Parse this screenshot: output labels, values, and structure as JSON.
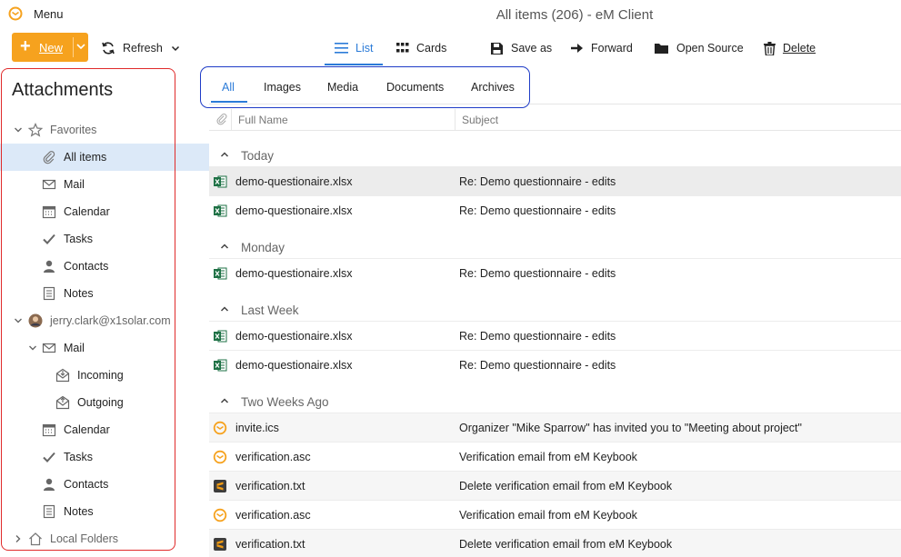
{
  "window": {
    "title": "All items (206) - eM Client",
    "menu_label": "Menu"
  },
  "toolbar": {
    "new_label": "New",
    "refresh_label": "Refresh",
    "list_label": "List",
    "cards_label": "Cards",
    "save_as_label": "Save as",
    "forward_label": "Forward",
    "open_source_label": "Open Source",
    "delete_label": "Delete"
  },
  "sidebar": {
    "title": "Attachments",
    "favorites_label": "Favorites",
    "account_label": "jerry.clark@x1solar.com",
    "local_folders_label": "Local Folders",
    "favorites": [
      {
        "label": "All items",
        "icon": "paperclip-icon"
      },
      {
        "label": "Mail",
        "icon": "mail-icon"
      },
      {
        "label": "Calendar",
        "icon": "calendar-icon"
      },
      {
        "label": "Tasks",
        "icon": "check-icon"
      },
      {
        "label": "Contacts",
        "icon": "person-icon"
      },
      {
        "label": "Notes",
        "icon": "note-icon"
      }
    ],
    "account": {
      "mail_label": "Mail",
      "incoming_label": "Incoming",
      "outgoing_label": "Outgoing",
      "calendar_label": "Calendar",
      "tasks_label": "Tasks",
      "contacts_label": "Contacts",
      "notes_label": "Notes"
    }
  },
  "tabs": [
    "All",
    "Images",
    "Media",
    "Documents",
    "Archives"
  ],
  "columns": {
    "full_name": "Full Name",
    "subject": "Subject"
  },
  "groups": [
    "Today",
    "Monday",
    "Last Week",
    "Two Weeks Ago"
  ],
  "rows": [
    {
      "name": "demo-questionaire.xlsx",
      "subject": "Re: Demo questionnaire - edits",
      "icon": "excel-icon"
    },
    {
      "name": "demo-questionaire.xlsx",
      "subject": "Re: Demo questionnaire - edits",
      "icon": "excel-icon"
    },
    {
      "name": "demo-questionaire.xlsx",
      "subject": "Re: Demo questionnaire - edits",
      "icon": "excel-icon"
    },
    {
      "name": "demo-questionaire.xlsx",
      "subject": "Re: Demo questionnaire - edits",
      "icon": "excel-icon"
    },
    {
      "name": "demo-questionaire.xlsx",
      "subject": "Re: Demo questionnaire - edits",
      "icon": "excel-icon"
    },
    {
      "name": "invite.ics",
      "subject": "Organizer \"Mike Sparrow\" has invited you to \"Meeting about project\"",
      "icon": "emclient-icon"
    },
    {
      "name": "verification.asc",
      "subject": "Verification email from eM Keybook",
      "icon": "emclient-icon"
    },
    {
      "name": "verification.txt",
      "subject": "Delete verification email from eM Keybook",
      "icon": "sublime-icon"
    },
    {
      "name": "verification.asc",
      "subject": "Verification email from eM Keybook",
      "icon": "emclient-icon"
    },
    {
      "name": "verification.txt",
      "subject": "Delete verification email from eM Keybook",
      "icon": "sublime-icon"
    }
  ],
  "colors": {
    "accent": "#2b7bd8",
    "new_button": "#f6a21e",
    "selected_bg": "#dce9f8"
  }
}
